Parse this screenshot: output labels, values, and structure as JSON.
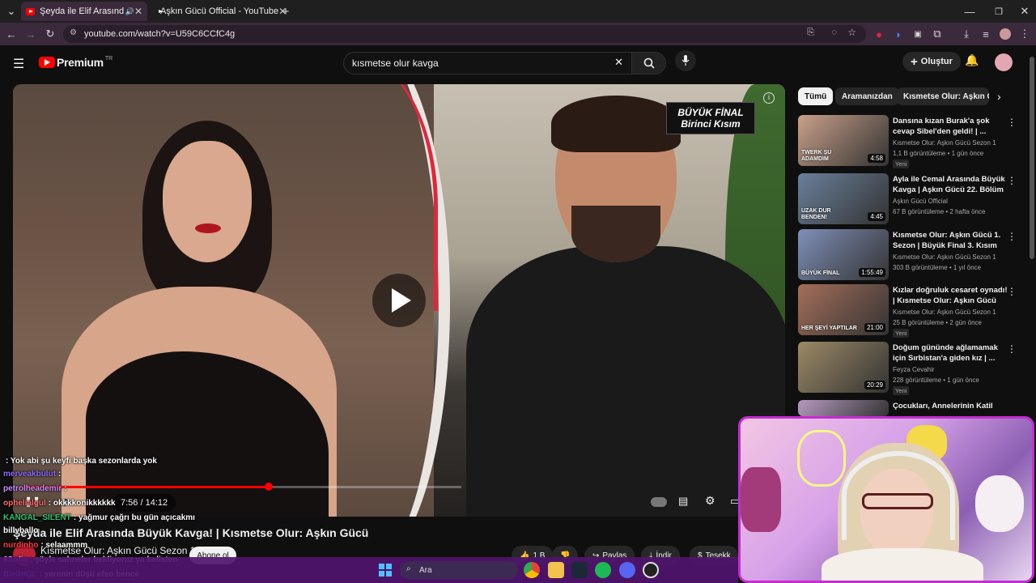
{
  "browser": {
    "tabs": [
      {
        "title": "Şeyda ile Elif Arasında Büyük",
        "active": true
      },
      {
        "title": "Aşkın Gücü Official - YouTube",
        "active": false
      }
    ],
    "new_tab": "+",
    "url": "youtube.com/watch?v=U59C6CCfC4g"
  },
  "youtube": {
    "logo": "Premium",
    "logo_region": "TR",
    "search_value": "kısmetse olur kavga",
    "create_label": "Oluştur"
  },
  "player": {
    "badge_line1": "BÜYÜK FİNAL",
    "badge_line2": "Birinci Kısım",
    "time": "7:56 / 14:12",
    "progress_fraction": 0.56,
    "state": "paused"
  },
  "video": {
    "title": "Şeyda ile Elif Arasında Büyük Kavga! | Kısmetse Olur: Aşkın Gücü",
    "channel": "Kısmetse Olur: Aşkın Gücü Sezon 1",
    "subscribe": "Abone ol",
    "likes": "1 B",
    "share": "Paylaş",
    "download": "İndir",
    "thanks": "Teşekk"
  },
  "chips": [
    "Tümü",
    "Aramanızdan",
    "Kısmetse Olur: Aşkın Gü"
  ],
  "related": [
    {
      "title": "Dansına kızan Burak'a şok cevap Sibel'den geldi! | ...",
      "channel": "Kısmetse Olur: Aşkın Gücü Sezon 1",
      "meta": "1,1 B görüntüleme • 1 gün önce",
      "badge": "Yeni",
      "duration": "4:58",
      "thumb_color": "#c9a08a",
      "thumb_text": "TWERK ŞU ADAMDIM"
    },
    {
      "title": "Ayla ile Cemal Arasında Büyük Kavga | Aşkın Gücü 22. Bölüm",
      "channel": "Aşkın Gücü Official",
      "meta": "67 B görüntüleme • 2 hafta önce",
      "badge": "",
      "duration": "4:45",
      "thumb_color": "#6a7f9a",
      "thumb_text": "UZAK DUR BENDEN!"
    },
    {
      "title": "Kısmetse Olur: Aşkın Gücü 1. Sezon | Büyük Final 3. Kısım",
      "channel": "Kısmetse Olur: Aşkın Gücü Sezon 1",
      "meta": "303 B görüntüleme • 1 yıl önce",
      "badge": "",
      "duration": "1:55:49",
      "thumb_color": "#7f8fb8",
      "thumb_text": "BÜYÜK FİNAL"
    },
    {
      "title": "Kızlar doğruluk cesaret oynadı! | Kısmetse Olur: Aşkın Gücü",
      "channel": "Kısmetse Olur: Aşkın Gücü Sezon 1",
      "meta": "25 B görüntüleme • 2 gün önce",
      "badge": "Yeni",
      "duration": "21:00",
      "thumb_color": "#a46e5a",
      "thumb_text": "HER ŞEYİ YAPTILAR"
    },
    {
      "title": "Doğum gününde ağlamamak için Sırbistan'a giden kız | ...",
      "channel": "Feyza Cevahir",
      "meta": "228 görüntüleme • 1 gün önce",
      "badge": "Yeni",
      "duration": "20:29",
      "thumb_color": "#9c8a66",
      "thumb_text": ""
    },
    {
      "title": "Çocukları, Annelerinin Katil",
      "channel": "",
      "meta": "",
      "badge": "",
      "duration": "",
      "thumb_color": "#b79ac1",
      "thumb_text": ""
    }
  ],
  "chat": [
    {
      "user": "",
      "msg": ": Yok abi şu keyfi başka sezonlarda yok",
      "color": "#ff4d4d"
    },
    {
      "user": "merveakbulut",
      "msg": ":",
      "color": "#8f6bff"
    },
    {
      "user": "petrolheademir",
      "msg": ":",
      "color": "#c88cff"
    },
    {
      "user": "ophelialgul",
      "msg": ": okkkkonikkkkkk",
      "color": "#ff6b6b"
    },
    {
      "user": "KANGAL_SILENT",
      "msg": ": yağmur çağrı bu gün açıcakmı",
      "color": "#38c172"
    },
    {
      "user": "billyballo",
      "msg": "",
      "color": "#ffffff"
    },
    {
      "user": "nurdinho",
      "msg": ": selaammm",
      "color": "#ff3b3b"
    },
    {
      "user": "6Sofia",
      "msg": ": şöyle sahneler bekliyoruz ya belisten",
      "color": "#e0a0ff"
    },
    {
      "user": "BleibtQL",
      "msg": ": yarenin düşü efso bence",
      "color": "#5aa0ff"
    }
  ],
  "taskbar": {
    "search_placeholder": "Ara"
  },
  "icons": {
    "menu": "hamburger-icon",
    "search": "search-icon",
    "mic": "mic-icon",
    "bell": "bell-icon"
  }
}
